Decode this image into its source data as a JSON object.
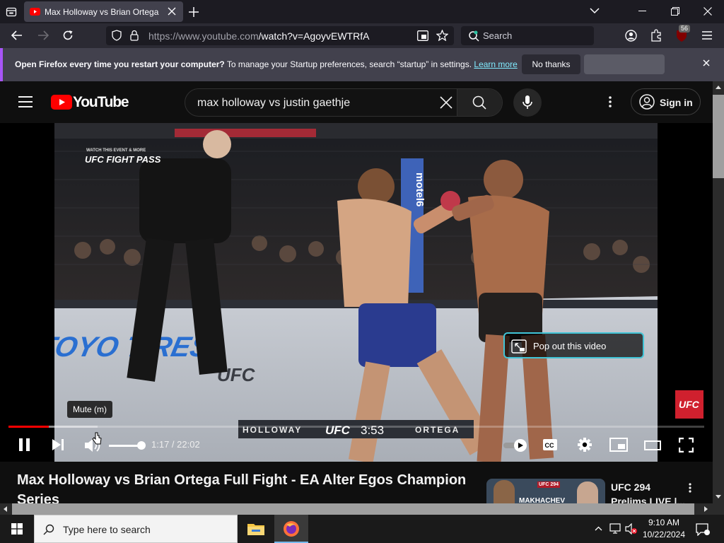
{
  "browser": {
    "tab_title": "Max Holloway vs Brian Ortega Full Fight - EA Alter Egos Champion Series",
    "url_host": "https://www.youtube.com",
    "url_path": "/watch?v=AgoyvEWTRfA",
    "search_placeholder": "Search",
    "badge_count": "56",
    "infobar": {
      "bold": "Open Firefox every time you restart your computer?",
      "text": " To manage your Startup preferences, search “startup” in settings.",
      "link": "Learn more",
      "no_thanks": "No thanks"
    }
  },
  "youtube": {
    "logo_text": "YouTube",
    "search_query": "max holloway vs justin gaethje",
    "sign_in": "Sign in",
    "player": {
      "tooltip": "Mute (m)",
      "current_time": "1:17",
      "duration": "22:02",
      "time_display": "1:17 / 22:02",
      "popout_label": "Pop out this video",
      "progress_fraction": 0.058,
      "buffered_fraction": 0.128,
      "volume_fraction": 1.0
    },
    "video": {
      "watermark": "UFC FIGHT PASS",
      "watermark_small": "WATCH THIS EVENT & MORE",
      "banner": "TOYO TIRES",
      "mat_logo": "UFC",
      "sponsor_post": "motel6",
      "corner_logo": "UFC",
      "scorebug": {
        "left": "HOLLOWAY",
        "center": "UFC",
        "clock": "3:53",
        "right": "ORTEGA"
      }
    },
    "video_title": "Max Holloway vs Brian Ortega Full Fight - EA Alter Egos Champion Series",
    "recommended": {
      "title": "UFC 294 Prelims LIVE |...",
      "thumb_text": "MAKHACHEV",
      "thumb_badge": "UFC 294"
    }
  },
  "taskbar": {
    "search_placeholder": "Type here to search",
    "time": "9:10 AM",
    "date": "10/22/2024"
  },
  "colors": {
    "youtube_red": "#ff0000",
    "infobar_accent": "#a855f7",
    "popout_border": "#40c4d6"
  }
}
